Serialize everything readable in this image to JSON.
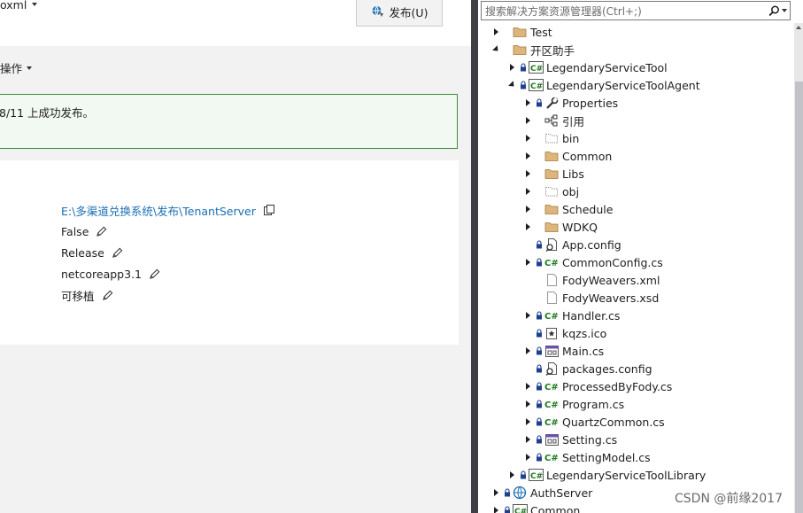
{
  "publish": {
    "profile_name": "oxml",
    "publish_button": "发布(U)",
    "actions_label": "操作",
    "success_message": "8/11 上成功发布。",
    "target_location": "E:\\多渠道兑换系统\\发布\\TenantServer",
    "delete_existing": "False",
    "configuration": "Release",
    "target_framework": "netcoreapp3.1",
    "deployment_mode": "可移植"
  },
  "explorer": {
    "search_placeholder": "搜索解决方案资源管理器(Ctrl+;)",
    "items": [
      {
        "label": "Test",
        "depth": 0,
        "expander": "collapsed",
        "lock": false,
        "icon": "folder-icon"
      },
      {
        "label": "开区助手",
        "depth": 0,
        "expander": "expanded",
        "lock": false,
        "icon": "folder-icon"
      },
      {
        "label": "LegendaryServiceTool",
        "depth": 1,
        "expander": "collapsed",
        "lock": true,
        "icon": "csharp-project-icon"
      },
      {
        "label": "LegendaryServiceToolAgent",
        "depth": 1,
        "expander": "expanded",
        "lock": true,
        "icon": "csharp-project-icon"
      },
      {
        "label": "Properties",
        "depth": 2,
        "expander": "collapsed",
        "lock": true,
        "icon": "wrench-icon"
      },
      {
        "label": "引用",
        "depth": 2,
        "expander": "collapsed",
        "lock": false,
        "icon": "references-icon"
      },
      {
        "label": "bin",
        "depth": 2,
        "expander": "collapsed",
        "lock": false,
        "icon": "hidden-folder-icon"
      },
      {
        "label": "Common",
        "depth": 2,
        "expander": "collapsed",
        "lock": false,
        "icon": "folder-icon"
      },
      {
        "label": "Libs",
        "depth": 2,
        "expander": "collapsed",
        "lock": false,
        "icon": "folder-icon"
      },
      {
        "label": "obj",
        "depth": 2,
        "expander": "collapsed",
        "lock": false,
        "icon": "hidden-folder-icon"
      },
      {
        "label": "Schedule",
        "depth": 2,
        "expander": "collapsed",
        "lock": false,
        "icon": "folder-icon"
      },
      {
        "label": "WDKQ",
        "depth": 2,
        "expander": "collapsed",
        "lock": false,
        "icon": "folder-icon"
      },
      {
        "label": "App.config",
        "depth": 2,
        "expander": "none",
        "lock": true,
        "icon": "config-file-icon"
      },
      {
        "label": "CommonConfig.cs",
        "depth": 2,
        "expander": "collapsed",
        "lock": true,
        "icon": "csharp-file-icon"
      },
      {
        "label": "FodyWeavers.xml",
        "depth": 2,
        "expander": "none",
        "lock": false,
        "icon": "file-icon"
      },
      {
        "label": "FodyWeavers.xsd",
        "depth": 2,
        "expander": "none",
        "lock": false,
        "icon": "file-icon"
      },
      {
        "label": "Handler.cs",
        "depth": 2,
        "expander": "collapsed",
        "lock": true,
        "icon": "csharp-file-icon"
      },
      {
        "label": "kqzs.ico",
        "depth": 2,
        "expander": "none",
        "lock": true,
        "icon": "ico-file-icon"
      },
      {
        "label": "Main.cs",
        "depth": 2,
        "expander": "collapsed",
        "lock": true,
        "icon": "form-file-icon"
      },
      {
        "label": "packages.config",
        "depth": 2,
        "expander": "none",
        "lock": true,
        "icon": "config-file-icon"
      },
      {
        "label": "ProcessedByFody.cs",
        "depth": 2,
        "expander": "collapsed",
        "lock": true,
        "icon": "csharp-file-icon"
      },
      {
        "label": "Program.cs",
        "depth": 2,
        "expander": "collapsed",
        "lock": true,
        "icon": "csharp-file-icon"
      },
      {
        "label": "QuartzCommon.cs",
        "depth": 2,
        "expander": "collapsed",
        "lock": true,
        "icon": "csharp-file-icon"
      },
      {
        "label": "Setting.cs",
        "depth": 2,
        "expander": "collapsed",
        "lock": true,
        "icon": "form-file-icon"
      },
      {
        "label": "SettingModel.cs",
        "depth": 2,
        "expander": "collapsed",
        "lock": true,
        "icon": "csharp-file-icon"
      },
      {
        "label": "LegendaryServiceToolLibrary",
        "depth": 1,
        "expander": "collapsed",
        "lock": true,
        "icon": "csharp-project-icon"
      },
      {
        "label": "AuthServer",
        "depth": 0,
        "expander": "collapsed",
        "lock": true,
        "icon": "web-project-icon"
      },
      {
        "label": "Common",
        "depth": 0,
        "expander": "collapsed",
        "lock": true,
        "icon": "csharp-project-icon"
      }
    ]
  },
  "watermark": "CSDN @前缘2017",
  "colors": {
    "link": "#1a6fb4",
    "success_border": "#3c8c3c",
    "csharp_green": "#1c7a1c",
    "folder": "#dcb67a"
  }
}
